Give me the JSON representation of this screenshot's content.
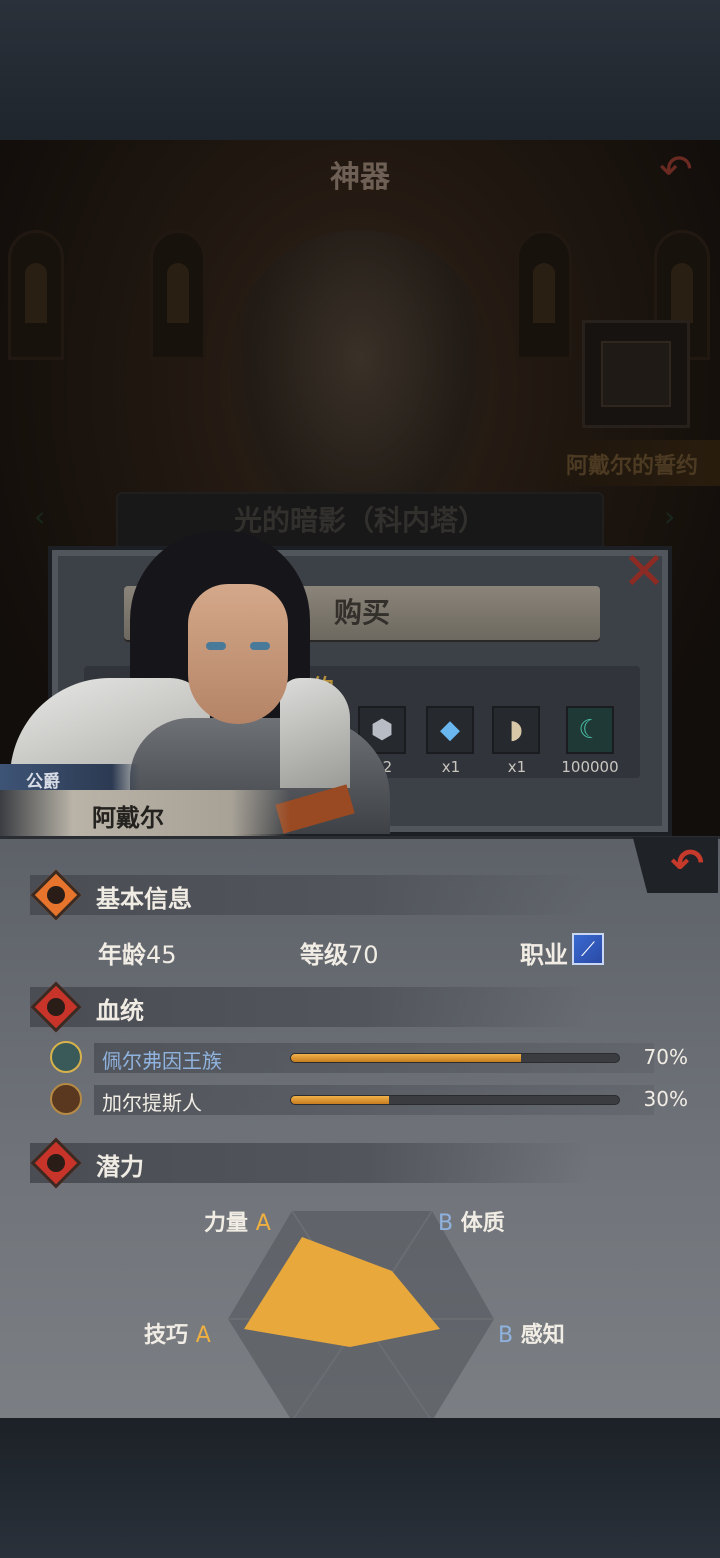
{
  "scene": {
    "title": "神器",
    "oath_banner": "阿戴尔的誓约",
    "subtitle": "光的暗影（科内塔）"
  },
  "dialog": {
    "buy_label": "购买",
    "strip_title": "的誓约",
    "items": [
      {
        "icon": "stone-icon",
        "qty": "x2"
      },
      {
        "icon": "crystal-icon",
        "qty": "x1"
      },
      {
        "icon": "horn-icon",
        "qty": "x1"
      },
      {
        "icon": "gold-coin-icon",
        "qty": "100000"
      }
    ]
  },
  "character": {
    "rank": "公爵",
    "name": "阿戴尔"
  },
  "basic_info": {
    "title": "基本信息",
    "age_label": "年龄",
    "age": "45",
    "level_label": "等级",
    "level": "70",
    "job_label": "职业"
  },
  "bloodline": {
    "title": "血统",
    "rows": [
      {
        "name": "佩尔弗因王族",
        "percent_text": "70%",
        "fraction": 0.7
      },
      {
        "name": "加尔提斯人",
        "percent_text": "30%",
        "fraction": 0.3
      }
    ]
  },
  "potential": {
    "title": "潜力",
    "stats": [
      {
        "label": "力量",
        "grade": "A"
      },
      {
        "label": "体质",
        "grade": "B"
      },
      {
        "label": "感知",
        "grade": "B"
      },
      {
        "label": "技巧",
        "grade": "A"
      }
    ]
  },
  "colors": {
    "accent_orange": "#f2b24a",
    "close_red": "#c63a2c",
    "blue_text": "#8fb2de"
  }
}
